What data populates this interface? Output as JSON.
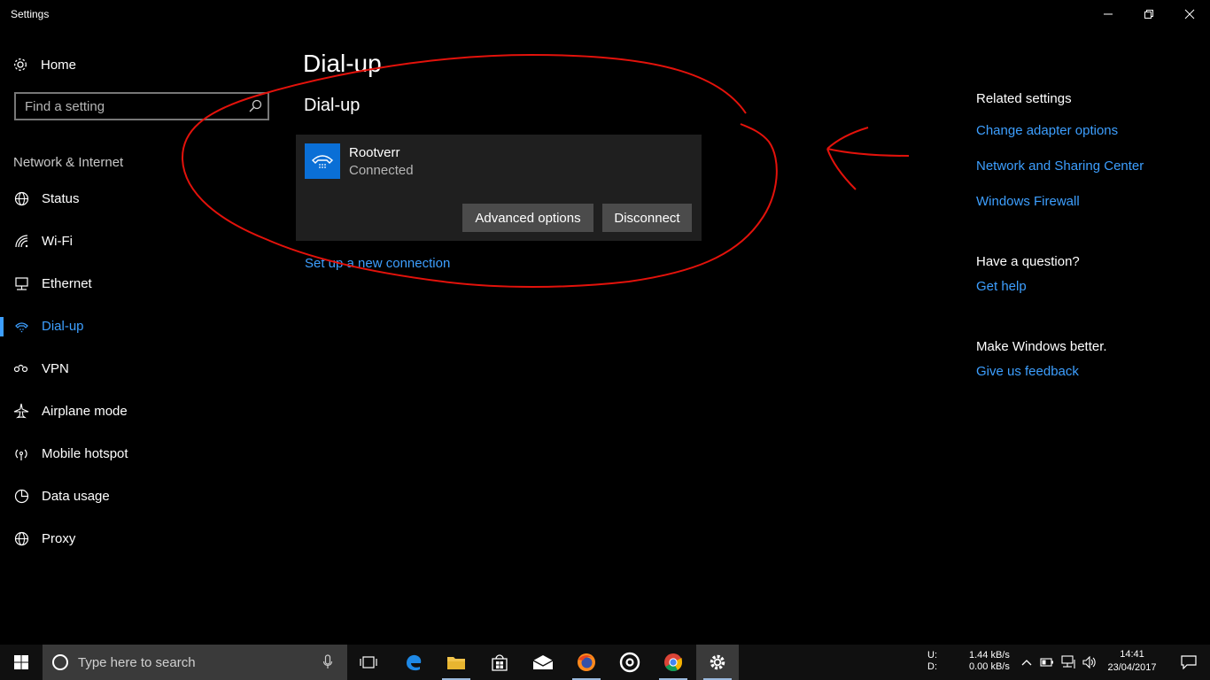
{
  "window": {
    "title": "Settings"
  },
  "sidebar": {
    "home_label": "Home",
    "search_placeholder": "Find a setting",
    "section_title": "Network & Internet",
    "items": [
      {
        "label": "Status",
        "icon": "globe-icon"
      },
      {
        "label": "Wi-Fi",
        "icon": "wifi-icon"
      },
      {
        "label": "Ethernet",
        "icon": "ethernet-icon"
      },
      {
        "label": "Dial-up",
        "icon": "dialup-phone-icon",
        "active": true
      },
      {
        "label": "VPN",
        "icon": "vpn-icon"
      },
      {
        "label": "Airplane mode",
        "icon": "airplane-icon"
      },
      {
        "label": "Mobile hotspot",
        "icon": "hotspot-icon"
      },
      {
        "label": "Data usage",
        "icon": "data-usage-icon"
      },
      {
        "label": "Proxy",
        "icon": "globe-icon"
      }
    ]
  },
  "main": {
    "title": "Dial-up",
    "subtitle": "Dial-up",
    "connection": {
      "name": "Rootverr",
      "status": "Connected",
      "advanced_label": "Advanced options",
      "disconnect_label": "Disconnect"
    },
    "setup_link": "Set up a new connection"
  },
  "related": {
    "heading": "Related settings",
    "links": [
      "Change adapter options",
      "Network and Sharing Center",
      "Windows Firewall"
    ],
    "question_heading": "Have a question?",
    "get_help": "Get help",
    "better_heading": "Make Windows better.",
    "feedback": "Give us feedback"
  },
  "taskbar": {
    "search_placeholder": "Type here to search",
    "apps": [
      "task-view-icon",
      "edge-icon",
      "file-explorer-icon",
      "store-icon",
      "mail-icon",
      "firefox-icon",
      "groove-icon",
      "chrome-icon",
      "settings-gear-icon"
    ],
    "net_upload_label": "U:",
    "net_download_label": "D:",
    "net_upload": "1.44 kB/s",
    "net_download": "0.00 kB/s",
    "time": "14:41",
    "date": "23/04/2017"
  },
  "colors": {
    "accent": "#3d9fff",
    "annotation": "#e3120b",
    "card": "#1f1f1f",
    "icon_tile": "#0a6fd6"
  }
}
